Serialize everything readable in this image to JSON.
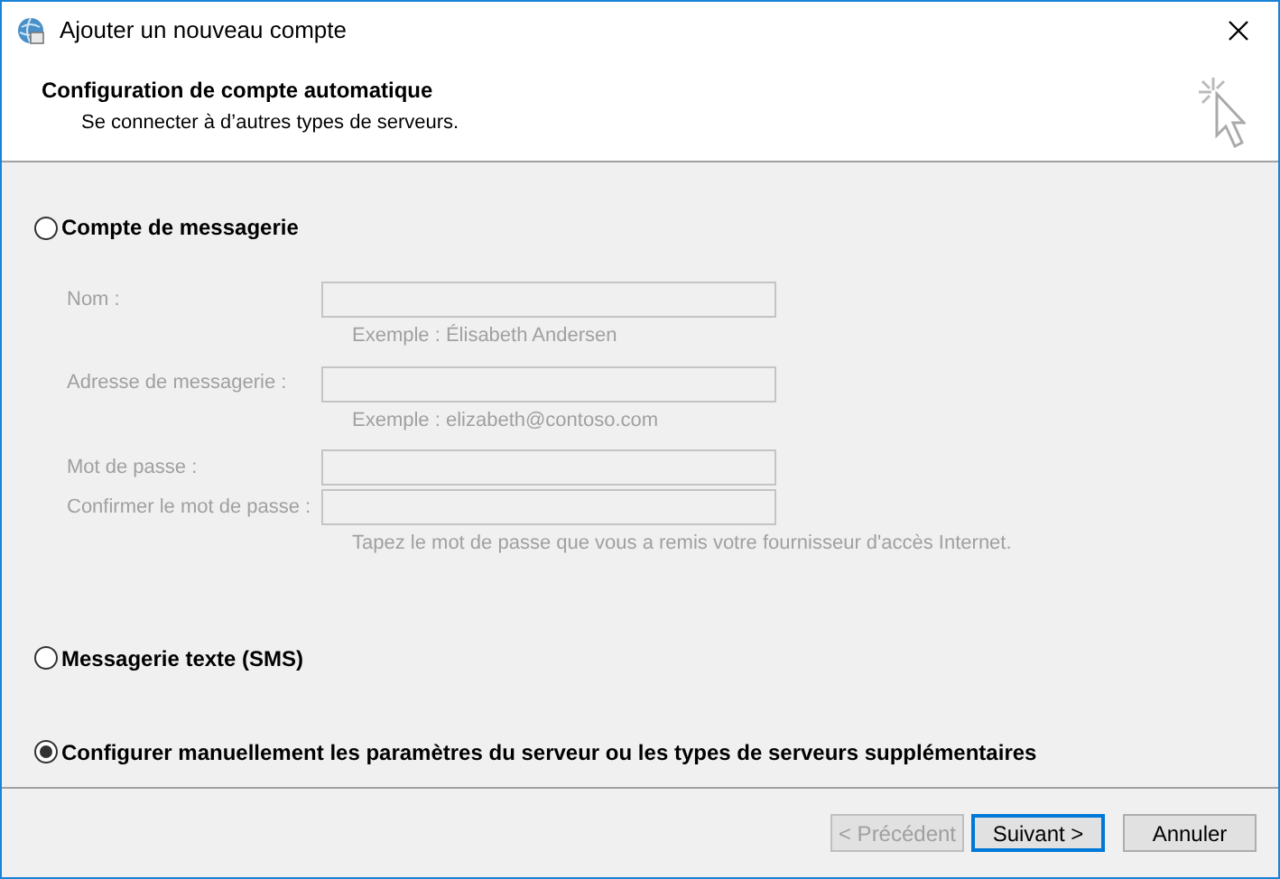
{
  "window": {
    "title": "Ajouter un nouveau compte"
  },
  "header": {
    "title": "Configuration de compte automatique",
    "subtitle": "Se connecter à d’autres types de serveurs."
  },
  "options": [
    {
      "label": "Compte de messagerie",
      "selected": false,
      "fields": [
        {
          "label": "Nom :",
          "hint": "Exemple : Élisabeth Andersen",
          "disabled": true
        },
        {
          "label": "Adresse de messagerie :",
          "hint": "Exemple : elizabeth@contoso.com",
          "disabled": true
        },
        {
          "label": "Mot de passe :",
          "disabled": true
        },
        {
          "label": "Confirmer le mot de passe :",
          "hint": "Tapez le mot de passe que vous a remis votre fournisseur d'accès Internet.",
          "disabled": true
        }
      ]
    },
    {
      "label": "Messagerie texte (SMS)",
      "selected": false
    },
    {
      "label": "Configurer manuellement les paramètres du serveur ou les types de serveurs supplémentaires",
      "selected": true
    }
  ],
  "buttons": [
    {
      "label": "< Précédent",
      "disabled": true,
      "default": false
    },
    {
      "label": "Suivant >",
      "disabled": false,
      "default": true
    },
    {
      "label": "Annuler",
      "disabled": false,
      "default": false
    }
  ]
}
